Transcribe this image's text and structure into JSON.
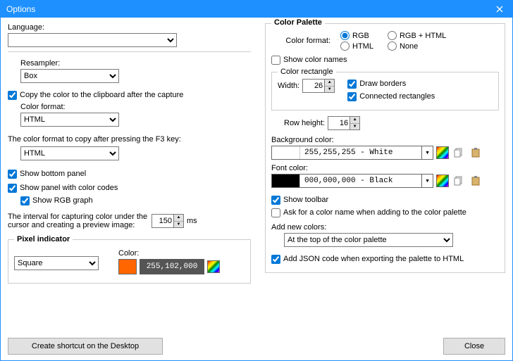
{
  "window": {
    "title": "Options"
  },
  "left": {
    "language_label": "Language:",
    "language_value": "",
    "resampler_label": "Resampler:",
    "resampler_value": "Box",
    "copy_clipboard": "Copy the color to the clipboard after the capture",
    "copy_clipboard_checked": true,
    "color_format_label": "Color format:",
    "color_format_value": "HTML",
    "f3_text": "The color format to copy after pressing the F3 key:",
    "f3_value": "HTML",
    "show_bottom_panel": "Show bottom panel",
    "show_bottom_panel_checked": true,
    "show_panel_codes": "Show panel with color codes",
    "show_panel_codes_checked": true,
    "show_rgb_graph": "Show RGB graph",
    "show_rgb_graph_checked": true,
    "interval_text": "The interval for capturing color under the cursor and creating a preview image:",
    "interval_value": "150",
    "interval_unit": "ms",
    "pixel_indicator_title": "Pixel indicator",
    "pi_shape": "Square",
    "pi_color_label": "Color:",
    "pi_color_value": "255,102,000",
    "pi_color_hex": "#ff6600",
    "create_shortcut": "Create shortcut on the Desktop"
  },
  "right": {
    "palette_title": "Color Palette",
    "color_format_label": "Color format:",
    "radios": {
      "rgb": "RGB",
      "rgb_html": "RGB + HTML",
      "html": "HTML",
      "none": "None"
    },
    "radio_selected": "rgb",
    "show_color_names": "Show color names",
    "show_color_names_checked": false,
    "rect_title": "Color rectangle",
    "width_label": "Width:",
    "width_value": "26",
    "draw_borders": "Draw borders",
    "draw_borders_checked": true,
    "connected_rects": "Connected rectangles",
    "connected_rects_checked": true,
    "row_height_label": "Row height:",
    "row_height_value": "16",
    "bg_label": "Background color:",
    "bg_value": "255,255,255 - White",
    "bg_hex": "#ffffff",
    "font_label": "Font color:",
    "font_value": "000,000,000 - Black",
    "font_hex": "#000000",
    "show_toolbar": "Show toolbar",
    "show_toolbar_checked": true,
    "ask_name": "Ask for a color name when adding to the color palette",
    "ask_name_checked": false,
    "add_new_label": "Add new colors:",
    "add_new_value": "At the top of the color palette",
    "add_json": "Add JSON code when exporting the palette to HTML",
    "add_json_checked": true
  },
  "footer": {
    "close": "Close"
  }
}
